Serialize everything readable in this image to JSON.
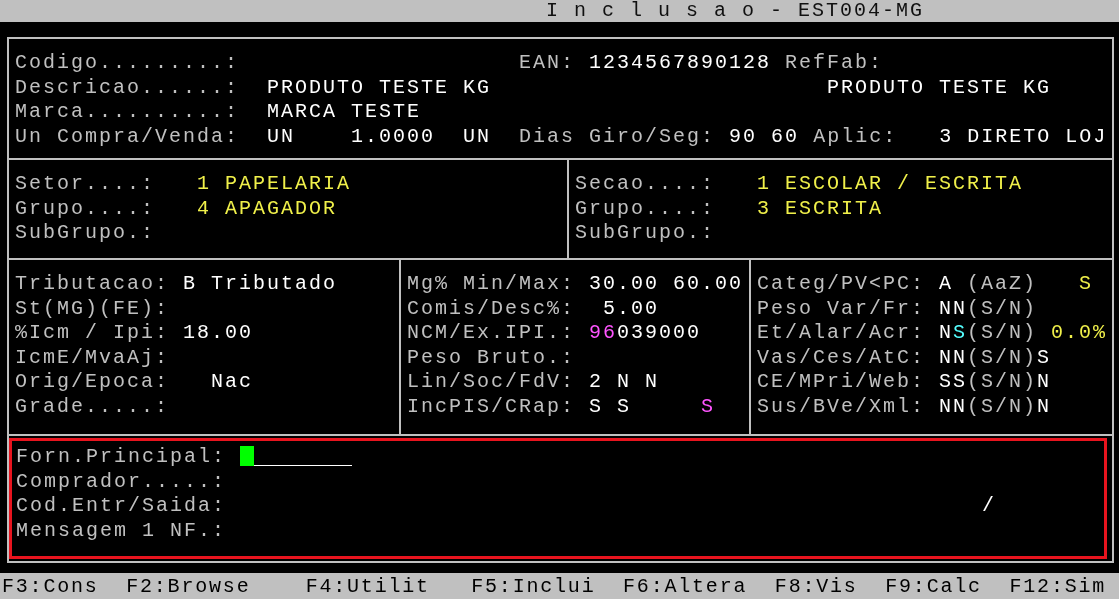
{
  "title": "I n c l u s a o - EST004-MG",
  "header": {
    "rows": [
      {
        "label": "Codigo.........:",
        "right": [
          {
            "text": "EAN:",
            "kind": "label"
          },
          {
            "text": "1234567890128",
            "kind": "value"
          },
          {
            "text": "RefFab:",
            "kind": "label"
          }
        ]
      },
      {
        "label": "Descricao......:",
        "value": [
          {
            "text": "PRODUTO TESTE KG",
            "kind": "value"
          }
        ],
        "right": [
          {
            "text": "PRODUTO TESTE KG",
            "kind": "value"
          }
        ]
      },
      {
        "label": "Marca..........:",
        "value": [
          {
            "text": "MARCA TESTE",
            "kind": "value"
          }
        ]
      },
      {
        "label": "Un Compra/Venda:",
        "value": [
          {
            "text": "UN",
            "kind": "value"
          },
          {
            "text": "1.0000",
            "kind": "value"
          },
          {
            "text": "UN",
            "kind": "value"
          }
        ],
        "right": [
          {
            "text": "Dias Giro/Seg:",
            "kind": "label"
          },
          {
            "text": "90 60",
            "kind": "value"
          },
          {
            "text": "Aplic:",
            "kind": "label"
          },
          {
            "text": "3 DIRETO LOJ",
            "kind": "value"
          }
        ]
      }
    ]
  },
  "classification": {
    "columns": [
      {
        "rows": [
          {
            "label": "Setor....:",
            "value": [
              {
                "text": "1 PAPELARIA",
                "kind": "yellow"
              }
            ]
          },
          {
            "label": "Grupo....:",
            "value": [
              {
                "text": "4 APAGADOR",
                "kind": "yellow"
              }
            ]
          },
          {
            "label": "SubGrupo.:"
          }
        ]
      },
      {
        "rows": [
          {
            "label": "Secao....:",
            "value": [
              {
                "text": "1 ESCOLAR / ESCRITA",
                "kind": "yellow"
              }
            ]
          },
          {
            "label": "Grupo....:",
            "value": [
              {
                "text": "3 ESCRITA",
                "kind": "yellow"
              }
            ]
          },
          {
            "label": "SubGrupo.:"
          }
        ]
      }
    ]
  },
  "fiscal": {
    "columns": [
      {
        "rows": [
          {
            "label": "Tributacao:",
            "value": [
              {
                "text": "B Tributado",
                "kind": "value"
              }
            ]
          },
          {
            "label": "St(MG)(FE):"
          },
          {
            "label": "%Icm / Ipi:",
            "value": [
              {
                "text": "18.00",
                "kind": "value"
              }
            ]
          },
          {
            "label": "IcmE/MvaAj:"
          },
          {
            "label": "Orig/Epoca:",
            "value": [
              {
                "text": "Nac",
                "kind": "value"
              }
            ]
          },
          {
            "label": "Grade.....:"
          }
        ]
      },
      {
        "rows": [
          {
            "label": "Mg% Min/Max:",
            "value": [
              {
                "text": "30.00 60.00",
                "kind": "value"
              }
            ]
          },
          {
            "label": "Comis/Desc%:",
            "value": [
              {
                "text": "5.00",
                "kind": "value"
              }
            ]
          },
          {
            "label": "NCM/Ex.IPI.:",
            "value": [
              {
                "text": "96",
                "kind": "magenta"
              },
              {
                "text": "039000",
                "kind": "value"
              }
            ]
          },
          {
            "label": "Peso Bruto.:"
          },
          {
            "label": "Lin/Soc/FdV:",
            "value": [
              {
                "text": "2 N N",
                "kind": "value"
              }
            ]
          },
          {
            "label": "IncPIS/CRap:",
            "value": [
              {
                "text": "S S",
                "kind": "value"
              }
            ],
            "flag": {
              "text": "S",
              "kind": "magenta"
            }
          }
        ]
      },
      {
        "rows": [
          {
            "label": "Categ/PV<PC:",
            "value": [
              {
                "text": "A",
                "kind": "value"
              }
            ],
            "hint": "(AaZ)",
            "flag": {
              "text": "S",
              "kind": "yellow"
            }
          },
          {
            "label": "Peso Var/Fr:",
            "value": [
              {
                "text": "NN",
                "kind": "value"
              }
            ],
            "hint": "(S/N)"
          },
          {
            "label": "Et/Alar/Acr:",
            "value": [
              {
                "text": "N",
                "kind": "value"
              },
              {
                "text": "S",
                "kind": "cyan"
              }
            ],
            "hint": "(S/N)",
            "flag": {
              "text": "0.0%",
              "kind": "yellow"
            }
          },
          {
            "label": "Vas/Ces/AtC:",
            "value": [
              {
                "text": "NN",
                "kind": "value"
              }
            ],
            "hint": "(S/N)",
            "flag": {
              "text": "S",
              "kind": "value"
            }
          },
          {
            "label": "CE/MPri/Web:",
            "value": [
              {
                "text": "SS",
                "kind": "value"
              }
            ],
            "hint": "(S/N)",
            "flag": {
              "text": "N",
              "kind": "value"
            }
          },
          {
            "label": "Sus/BVe/Xml:",
            "value": [
              {
                "text": "NN",
                "kind": "value"
              }
            ],
            "hint": "(S/N)",
            "flag": {
              "text": "N",
              "kind": "value"
            }
          }
        ]
      }
    ]
  },
  "supplier": {
    "rows": [
      {
        "label": "Forn.Principal:",
        "input": {
          "focused": true
        }
      },
      {
        "label": "Comprador.....:"
      },
      {
        "label": "Cod.Entr/Saida:",
        "value": [
          {
            "text": "/",
            "kind": "value"
          }
        ]
      },
      {
        "label": "Mensagem 1 NF.:"
      }
    ]
  },
  "function_keys": [
    {
      "label": "F3:Cons"
    },
    {
      "label": "F2:Browse"
    },
    {
      "label": "F4:Utilit"
    },
    {
      "label": "F5:Inclui"
    },
    {
      "label": "F6:Altera"
    },
    {
      "label": "F8:Vis"
    },
    {
      "label": "F9:Calc"
    },
    {
      "label": "F12:Sim"
    }
  ]
}
